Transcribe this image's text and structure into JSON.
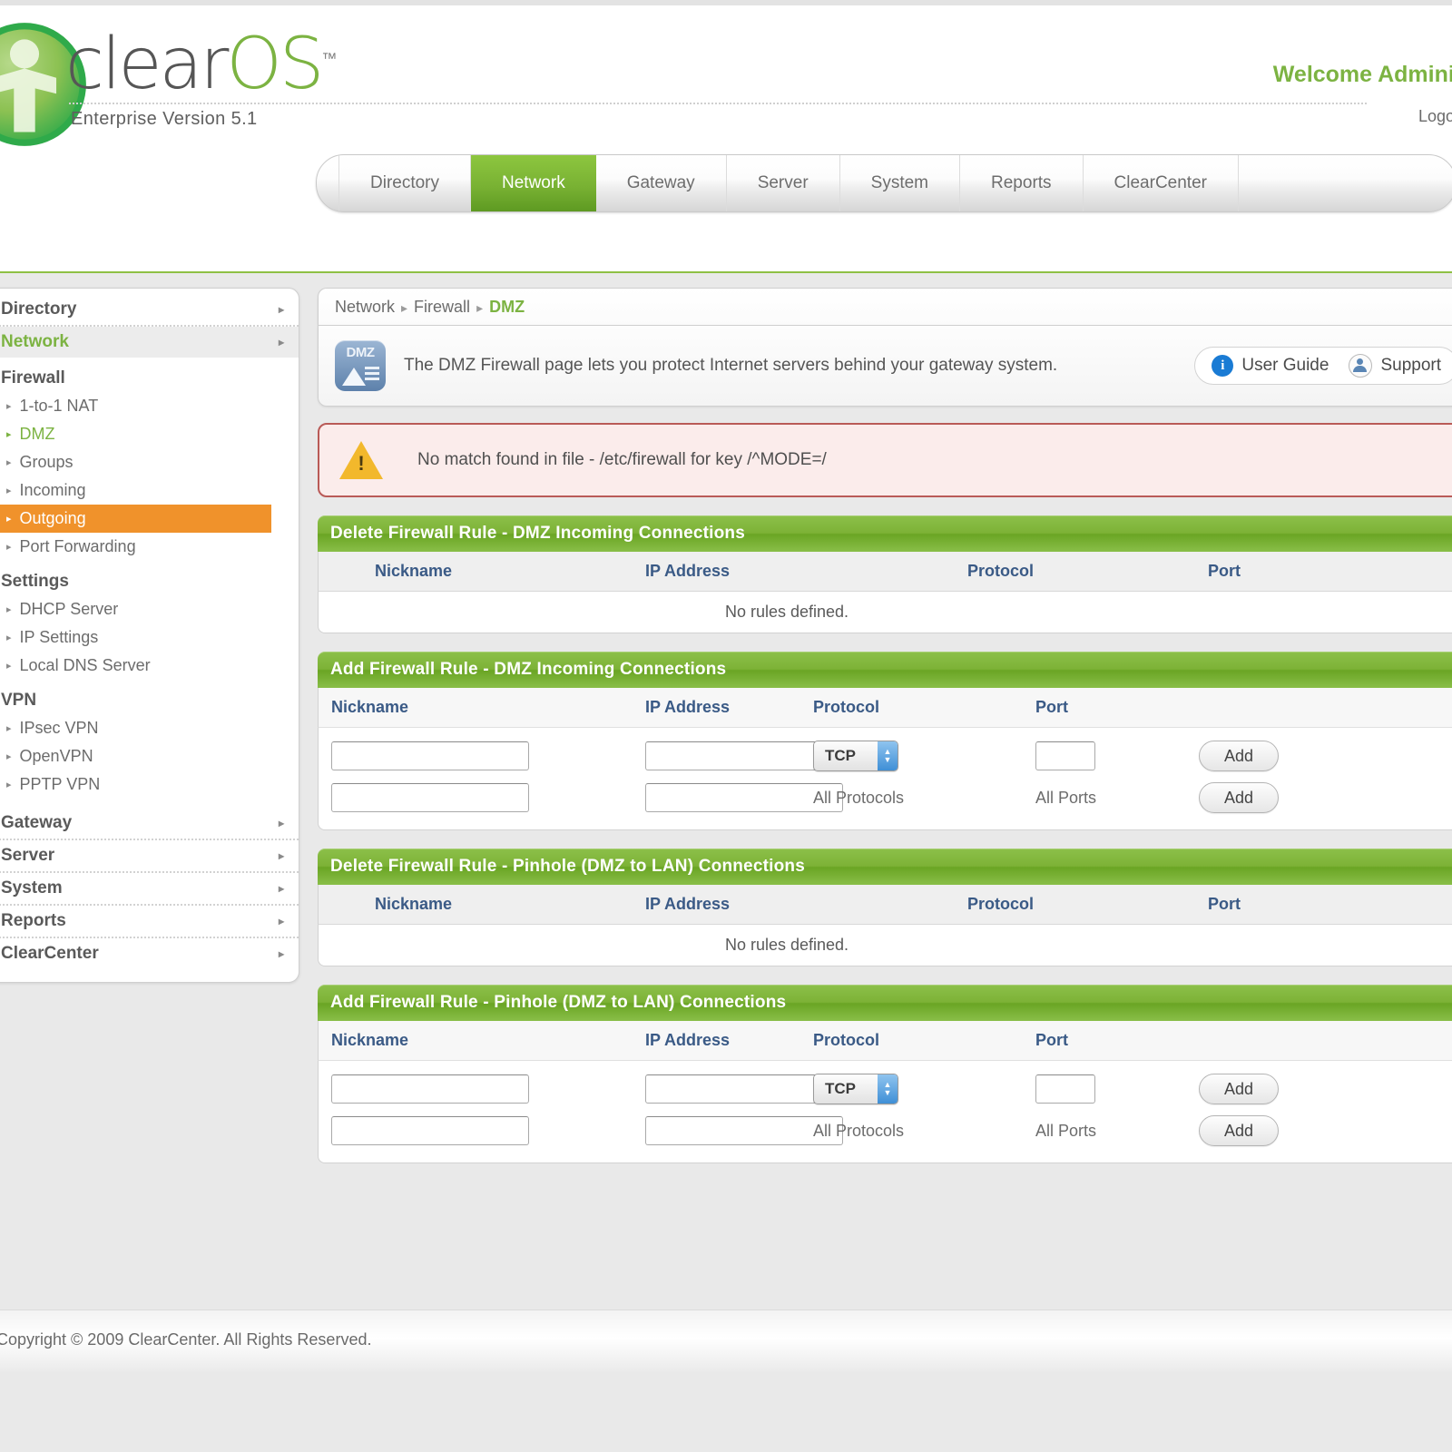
{
  "brand": {
    "name_clear": "clear",
    "name_os": "OS",
    "trademark": "™",
    "version": "Enterprise Version 5.1"
  },
  "header": {
    "welcome": "Welcome Administrator",
    "logout": "Logout"
  },
  "tabs": [
    {
      "label": "Directory",
      "active": false
    },
    {
      "label": "Network",
      "active": true
    },
    {
      "label": "Gateway",
      "active": false
    },
    {
      "label": "Server",
      "active": false
    },
    {
      "label": "System",
      "active": false
    },
    {
      "label": "Reports",
      "active": false
    },
    {
      "label": "ClearCenter",
      "active": false
    }
  ],
  "sidebar": {
    "top_items": [
      {
        "label": "Directory",
        "selected": false
      },
      {
        "label": "Network",
        "selected": true
      }
    ],
    "groups": [
      {
        "title": "Firewall",
        "items": [
          {
            "label": "1-to-1 NAT",
            "state": "normal"
          },
          {
            "label": "DMZ",
            "state": "current"
          },
          {
            "label": "Groups",
            "state": "normal"
          },
          {
            "label": "Incoming",
            "state": "normal"
          },
          {
            "label": "Outgoing",
            "state": "highlight"
          },
          {
            "label": "Port Forwarding",
            "state": "normal"
          }
        ]
      },
      {
        "title": "Settings",
        "items": [
          {
            "label": "DHCP Server",
            "state": "normal"
          },
          {
            "label": "IP Settings",
            "state": "normal"
          },
          {
            "label": "Local DNS Server",
            "state": "normal"
          }
        ]
      },
      {
        "title": "VPN",
        "items": [
          {
            "label": "IPsec VPN",
            "state": "normal"
          },
          {
            "label": "OpenVPN",
            "state": "normal"
          },
          {
            "label": "PPTP VPN",
            "state": "normal"
          }
        ]
      }
    ],
    "bottom_items": [
      {
        "label": "Gateway"
      },
      {
        "label": "Server"
      },
      {
        "label": "System"
      },
      {
        "label": "Reports"
      },
      {
        "label": "ClearCenter"
      }
    ],
    "arrow_glyph": "▸"
  },
  "breadcrumb": {
    "level1": "Network",
    "level2": "Firewall",
    "current": "DMZ",
    "separator": "▸"
  },
  "summary": {
    "icon_label": "DMZ",
    "text": "The DMZ Firewall page lets you protect Internet servers behind your gateway system.",
    "user_guide": "User Guide",
    "support": "Support",
    "info_glyph": "i"
  },
  "warning": {
    "message": "No match found in file - /etc/firewall for key /^MODE=/"
  },
  "columns": {
    "nickname": "Nickname",
    "ip_address": "IP Address",
    "protocol": "Protocol",
    "port": "Port"
  },
  "sections": [
    {
      "id": "delete-dmz-incoming",
      "title": "Delete Firewall Rule - DMZ Incoming Connections",
      "kind": "grid",
      "empty_text": "No rules defined."
    },
    {
      "id": "add-dmz-incoming",
      "title": "Add Firewall Rule - DMZ Incoming Connections",
      "kind": "form",
      "rows": [
        {
          "nickname_value": "",
          "ip_value": "",
          "protocol_control": "select",
          "protocol_value": "TCP",
          "port_control": "input",
          "port_value": "",
          "action": "Add"
        },
        {
          "nickname_value": "",
          "ip_value": "",
          "protocol_control": "text",
          "protocol_value": "All Protocols",
          "port_control": "text",
          "port_value": "All Ports",
          "action": "Add"
        }
      ]
    },
    {
      "id": "delete-pinhole",
      "title": "Delete Firewall Rule - Pinhole (DMZ to LAN) Connections",
      "kind": "grid",
      "empty_text": "No rules defined."
    },
    {
      "id": "add-pinhole",
      "title": "Add Firewall Rule - Pinhole (DMZ to LAN) Connections",
      "kind": "form",
      "rows": [
        {
          "nickname_value": "",
          "ip_value": "",
          "protocol_control": "select",
          "protocol_value": "TCP",
          "port_control": "input",
          "port_value": "",
          "action": "Add"
        },
        {
          "nickname_value": "",
          "ip_value": "",
          "protocol_control": "text",
          "protocol_value": "All Protocols",
          "port_control": "text",
          "port_value": "All Ports",
          "action": "Add"
        }
      ]
    }
  ],
  "footer": {
    "copyright": "Copyright © 2009 ClearCenter. All Rights Reserved."
  },
  "colors": {
    "brand_green": "#7cb342",
    "section_green": "#7db236",
    "highlight_orange": "#f0922b",
    "warning_border": "#b95a57",
    "warning_bg": "#fbeceb",
    "column_header_blue": "#3a5a86"
  }
}
